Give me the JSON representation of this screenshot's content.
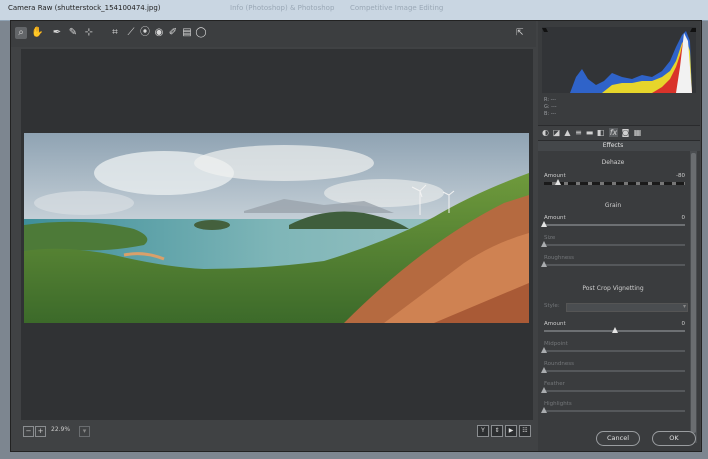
{
  "window": {
    "title": "Camera Raw (shutterstock_154100474.jpg)",
    "background_title_1": "Info (Photoshop) & Photoshop",
    "background_title_2": "Competitive Image Editing"
  },
  "toolbar": {
    "tools": [
      {
        "name": "zoom-icon",
        "glyph": "⌕",
        "active": true
      },
      {
        "name": "hand-icon",
        "glyph": "✋"
      },
      {
        "name": "white-balance-icon",
        "glyph": "✒"
      },
      {
        "name": "color-sampler-icon",
        "glyph": "✎"
      },
      {
        "name": "targeted-adjustment-icon",
        "glyph": "⊹"
      },
      {
        "name": "crop-icon",
        "glyph": "⌗"
      },
      {
        "name": "straighten-icon",
        "glyph": "⟋"
      },
      {
        "name": "spot-removal-icon",
        "glyph": "⦿"
      },
      {
        "name": "red-eye-icon",
        "glyph": "◉"
      },
      {
        "name": "adjustment-brush-icon",
        "glyph": "✐"
      },
      {
        "name": "graduated-filter-icon",
        "glyph": "▤"
      },
      {
        "name": "radial-filter-icon",
        "glyph": "◯"
      }
    ],
    "open_preferences_glyph": "⇱"
  },
  "status": {
    "zoom_minus": "−",
    "zoom_plus": "+",
    "zoom_value": "22.9%",
    "view_buttons": [
      "Y",
      "⇕",
      "▶",
      "☷"
    ]
  },
  "histogram": {
    "readout_r": "R:  ---",
    "readout_g": "G:  ---",
    "readout_b": "B:  ---"
  },
  "panel_tabs": [
    {
      "name": "basic-tab-icon",
      "glyph": "◐"
    },
    {
      "name": "tone-curve-tab-icon",
      "glyph": "◪"
    },
    {
      "name": "detail-tab-icon",
      "glyph": "▲"
    },
    {
      "name": "hsl-tab-icon",
      "glyph": "≡"
    },
    {
      "name": "split-toning-tab-icon",
      "glyph": "▬"
    },
    {
      "name": "lens-tab-icon",
      "glyph": "◧"
    },
    {
      "name": "effects-tab-icon",
      "glyph": "fx",
      "active": true
    },
    {
      "name": "camera-calibration-tab-icon",
      "glyph": "◙"
    },
    {
      "name": "presets-tab-icon",
      "glyph": "▦"
    }
  ],
  "effects": {
    "header": "Effects",
    "dehaze": {
      "title": "Dehaze",
      "amount_label": "Amount",
      "amount_value": "-80",
      "amount_fraction": 0.1
    },
    "grain": {
      "title": "Grain",
      "amount_label": "Amount",
      "amount_value": "0",
      "amount_fraction": 0.0,
      "size_label": "Size",
      "size_fraction": 0.0,
      "roughness_label": "Roughness",
      "roughness_fraction": 0.0
    },
    "vignetting": {
      "title": "Post Crop Vignetting",
      "style_label": "Style:",
      "amount_label": "Amount",
      "amount_value": "0",
      "amount_fraction": 0.5,
      "midpoint_label": "Midpoint",
      "midpoint_fraction": 0.0,
      "roundness_label": "Roundness",
      "roundness_fraction": 0.0,
      "feather_label": "Feather",
      "feather_fraction": 0.0,
      "highlights_label": "Highlights",
      "highlights_fraction": 0.0
    }
  },
  "buttons": {
    "cancel": "Cancel",
    "ok": "OK"
  },
  "colors": {
    "panel_bg": "#3a3c3e",
    "canvas_bg": "#303234",
    "accent_light": "#e4e4e4"
  }
}
